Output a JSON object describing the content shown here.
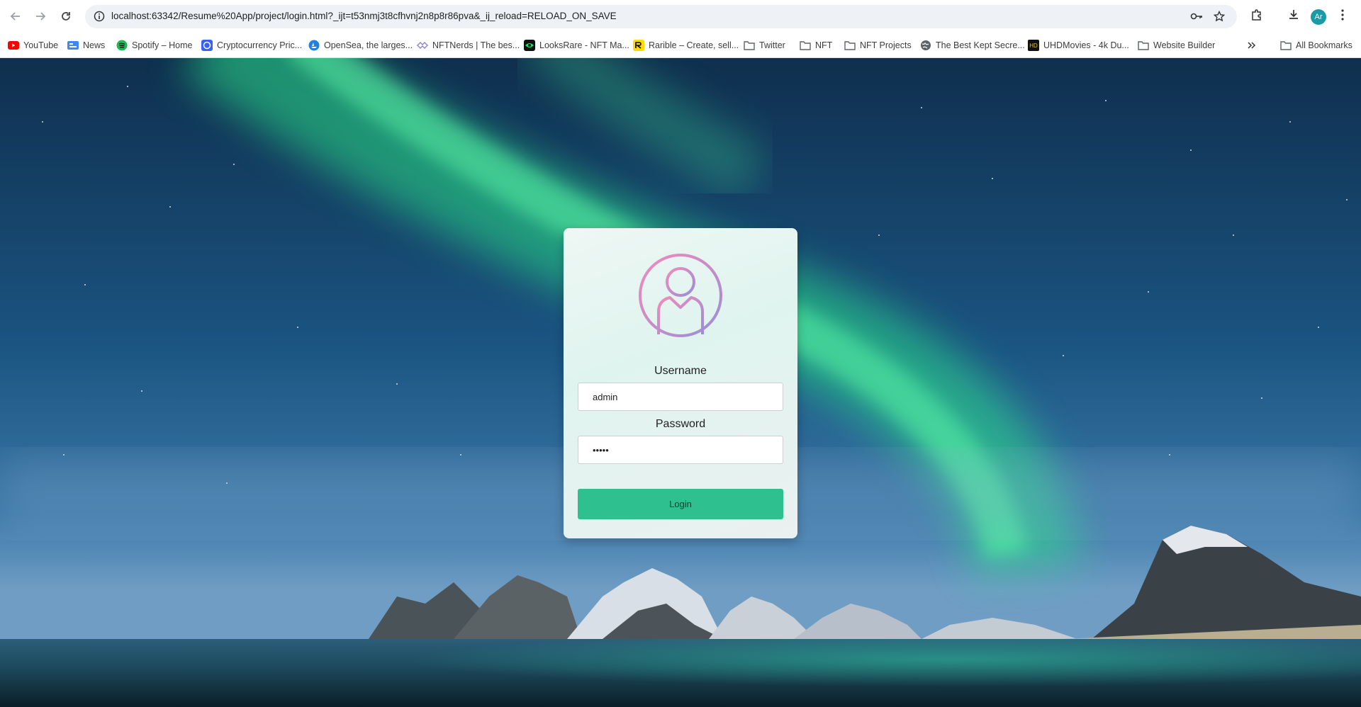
{
  "browser": {
    "url": "localhost:63342/Resume%20App/project/login.html?_ijt=t53nmj3t8cfhvnj2n8p8r86pva&_ij_reload=RELOAD_ON_SAVE",
    "profile_initials": "Ar",
    "bookmarks": [
      {
        "label": "YouTube",
        "icon": "youtube-icon",
        "color": "#ff0000"
      },
      {
        "label": "News",
        "icon": "google-news-icon",
        "color": "#4285f4"
      },
      {
        "label": "Spotify – Home",
        "icon": "spotify-icon",
        "color": "#1db954"
      },
      {
        "label": "Cryptocurrency Pric...",
        "icon": "coinmarketcap-icon",
        "color": "#3861fb"
      },
      {
        "label": "OpenSea, the larges...",
        "icon": "opensea-icon",
        "color": "#2081e2"
      },
      {
        "label": "NFTNerds | The bes...",
        "icon": "nftnerds-icon",
        "color": "#8a7fd6"
      },
      {
        "label": "LooksRare - NFT Ma...",
        "icon": "looksrare-icon",
        "color": "#0ce466"
      },
      {
        "label": "Rarible – Create, sell...",
        "icon": "rarible-icon",
        "color": "#fedb00"
      },
      {
        "label": "Twitter",
        "icon": "folder-icon",
        "color": "#5f6368"
      },
      {
        "label": "NFT",
        "icon": "folder-icon",
        "color": "#5f6368"
      },
      {
        "label": "NFT Projects",
        "icon": "folder-icon",
        "color": "#5f6368"
      },
      {
        "label": "The Best Kept Secre...",
        "icon": "globe-icon",
        "color": "#5f6368"
      },
      {
        "label": "UHDMovies - 4k Du...",
        "icon": "uhdmovies-icon",
        "color": "#f2c200"
      },
      {
        "label": "Website Builder",
        "icon": "folder-icon",
        "color": "#5f6368"
      }
    ],
    "all_bookmarks_label": "All Bookmarks"
  },
  "login": {
    "username_label": "Username",
    "username_value": "admin",
    "password_label": "Password",
    "password_value": "•••••",
    "button_label": "Login",
    "button_color": "#2ec08e"
  }
}
